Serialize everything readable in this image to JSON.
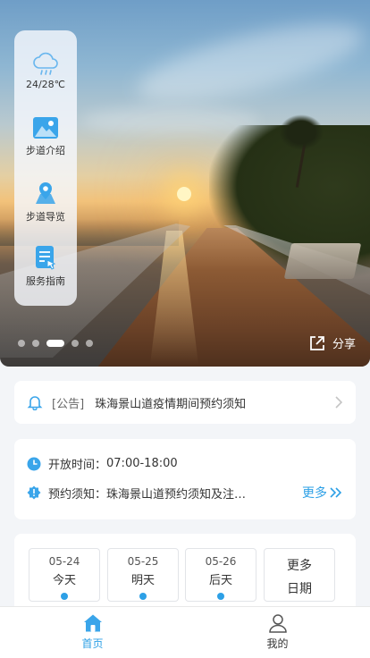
{
  "weather": {
    "temp": "24/28℃"
  },
  "side_menu": [
    {
      "label": "步道介绍",
      "icon": "mountain-icon"
    },
    {
      "label": "步道导览",
      "icon": "map-pin-icon"
    },
    {
      "label": "服务指南",
      "icon": "guide-doc-icon"
    }
  ],
  "carousel": {
    "dot_count": 5,
    "active_index": 2
  },
  "share": {
    "label": "分享",
    "icon": "share-icon"
  },
  "notice": {
    "tag": "[公告]",
    "text": "珠海景山道疫情期间预约须知",
    "icon": "bell-icon"
  },
  "info": {
    "hours_label": "开放时间：",
    "hours_value": "07:00-18:00",
    "booking_label": "预约须知：",
    "booking_value": "珠海景山道预约须知及注意事…",
    "more_label": "更多"
  },
  "dates": [
    {
      "date": "05-24",
      "day": "今天"
    },
    {
      "date": "05-25",
      "day": "明天"
    },
    {
      "date": "05-26",
      "day": "后天"
    }
  ],
  "more_dates": {
    "line1": "更多",
    "line2": "日期"
  },
  "tabbar": [
    {
      "label": "首页",
      "icon": "home-icon",
      "active": true
    },
    {
      "label": "我的",
      "icon": "user-icon",
      "active": false
    }
  ],
  "colors": {
    "accent": "#2da0e6",
    "icon_blue": "#3aa5ea"
  }
}
